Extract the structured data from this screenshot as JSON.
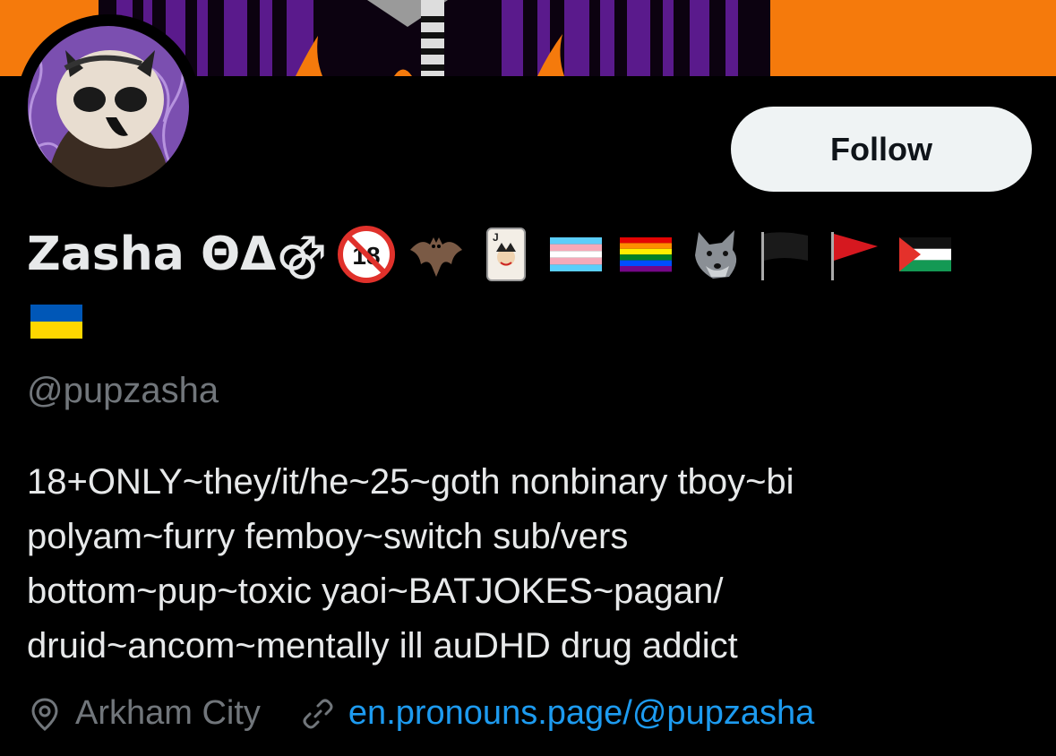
{
  "profile": {
    "display_name": "Zasha ΘΔ⚣",
    "handle": "@pupzasha",
    "bio": "18+ONLY~they/it/he~25~goth nonbinary tboy~bi\npolyam~furry femboy~switch sub/vers\nbottom~pup~toxic yaoi~BATJOKES~pagan/\ndruid~ancom~mentally ill auDHD drug addict",
    "location": "Arkham City",
    "website": "en.pronouns.page/@pupzasha"
  },
  "actions": {
    "follow_label": "Follow"
  },
  "icons": {
    "name_emojis": [
      "no-one-under-18-icon",
      "bat-icon",
      "joker-card-icon",
      "transgender-flag-icon",
      "rainbow-flag-icon",
      "wolf-icon",
      "black-flag-icon",
      "red-flag-icon",
      "palestine-flag-icon",
      "ukraine-flag-icon"
    ],
    "location": "location-pin-icon",
    "website": "link-icon"
  },
  "colors": {
    "background": "#000000",
    "banner_orange": "#f57a0c",
    "banner_purple": "#5a1a8c",
    "follow_button_bg": "#eff3f4",
    "link": "#1d9bf0",
    "secondary_text": "#71767b"
  }
}
